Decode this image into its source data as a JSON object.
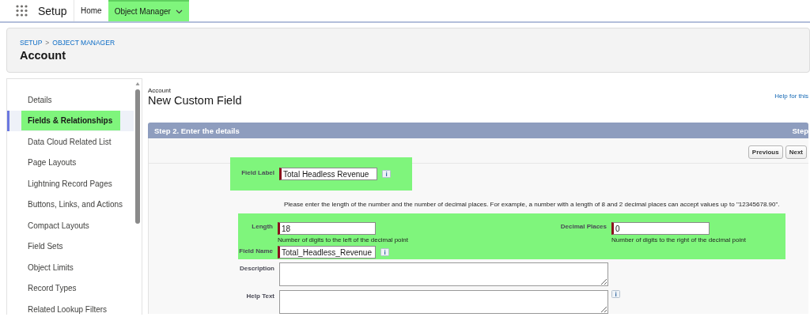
{
  "app": {
    "title": "Setup"
  },
  "nav_tabs": [
    {
      "label": "Home",
      "selected": false,
      "highlighted": false,
      "dropdown": false
    },
    {
      "label": "Object Manager",
      "selected": true,
      "highlighted": true,
      "dropdown": true
    }
  ],
  "header": {
    "breadcrumb": [
      "SETUP",
      "OBJECT MANAGER"
    ],
    "separator": ">",
    "title": "Account"
  },
  "sidebar": {
    "items": [
      {
        "label": "Details",
        "selected": false,
        "highlighted": false
      },
      {
        "label": "Fields & Relationships",
        "selected": true,
        "highlighted": true
      },
      {
        "label": "Data Cloud Related List",
        "selected": false,
        "highlighted": false
      },
      {
        "label": "Page Layouts",
        "selected": false,
        "highlighted": false
      },
      {
        "label": "Lightning Record Pages",
        "selected": false,
        "highlighted": false
      },
      {
        "label": "Buttons, Links, and Actions",
        "selected": false,
        "highlighted": false
      },
      {
        "label": "Compact Layouts",
        "selected": false,
        "highlighted": false
      },
      {
        "label": "Field Sets",
        "selected": false,
        "highlighted": false
      },
      {
        "label": "Object Limits",
        "selected": false,
        "highlighted": false
      },
      {
        "label": "Record Types",
        "selected": false,
        "highlighted": false
      },
      {
        "label": "Related Lookup Filters",
        "selected": false,
        "highlighted": false
      }
    ]
  },
  "page": {
    "object": "Account",
    "title": "New Custom Field",
    "help_link": "Help for this"
  },
  "step_bar": {
    "title": "Step 2. Enter the details",
    "right": "Step"
  },
  "buttons": [
    "Previous",
    "Next"
  ],
  "sections": [
    {
      "kind": "label",
      "highlighted": true,
      "rows": [
        {
          "label": "Field Label",
          "value": "Total Headless Revenue",
          "required": true,
          "info": true
        }
      ]
    },
    {
      "kind": "note",
      "text": "Please enter the length of the number and the number of decimal places. For example, a number with a length of 8 and 2 decimal places can accept values up to \"12345678.90\"."
    },
    {
      "kind": "number",
      "highlighted": true,
      "pairs": [
        {
          "label": "Length",
          "value": "18",
          "required": true,
          "hint": "Number of digits to the left of the decimal point"
        },
        {
          "label": "Decimal Places",
          "value": "0",
          "required": true,
          "hint": "Number of digits to the right of the decimal point"
        }
      ],
      "rows": [
        {
          "label": "Field Name",
          "value": "Total_Headless_Revenue",
          "required": true,
          "info": true
        }
      ]
    },
    {
      "kind": "text",
      "rows": [
        {
          "label": "Description",
          "info": false
        },
        {
          "label": "Help Text",
          "info": true
        }
      ]
    }
  ]
}
